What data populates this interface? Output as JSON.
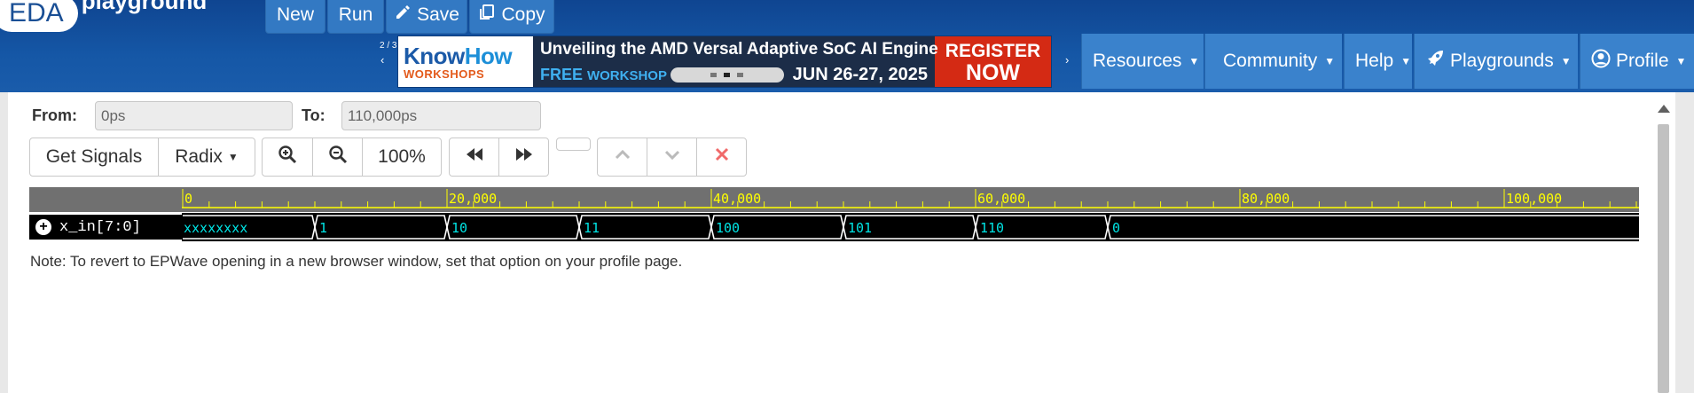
{
  "header": {
    "logo_text": "EDA",
    "logo_sub": "playground",
    "buttons": {
      "new": "New",
      "run": "Run",
      "save": "Save",
      "copy": "Copy"
    },
    "carousel_counter": "2 / 3",
    "ad": {
      "brand_a": "Know",
      "brand_b": "How",
      "brand_sub": "WORKSHOPS",
      "headline": "Unveiling the AMD Versal Adaptive SoC AI Engine",
      "free": "FREE",
      "workshop": "WORKSHOP",
      "date": "JUN 26-27, 2025",
      "cta_line1": "REGISTER",
      "cta_line2": "NOW"
    },
    "nav": [
      "Resources",
      "Community",
      "Help",
      "Playgrounds",
      "Profile"
    ]
  },
  "controls": {
    "from_label": "From:",
    "from_value": "0ps",
    "to_label": "To:",
    "to_value": "110,000ps",
    "get_signals": "Get Signals",
    "radix": "Radix",
    "zoom_level": "100%"
  },
  "waveform": {
    "ruler_labels": [
      "0",
      "20,000",
      "40,000",
      "60,000",
      "80,000",
      "100,000"
    ],
    "signal_name": "x_in[7:0]",
    "segments": [
      {
        "start": 0,
        "value": "xxxxxxxx"
      },
      {
        "start": 10000,
        "value": "1"
      },
      {
        "start": 20000,
        "value": "10"
      },
      {
        "start": 30000,
        "value": "11"
      },
      {
        "start": 40000,
        "value": "100"
      },
      {
        "start": 50000,
        "value": "101"
      },
      {
        "start": 60000,
        "value": "110"
      },
      {
        "start": 70000,
        "value": "0"
      }
    ],
    "time_end": 110000,
    "colors": {
      "ruler_text": "#ffff00",
      "value_text": "#00e5e5",
      "trace": "#ffffff"
    }
  },
  "note": "Note: To revert to EPWave opening in a new browser window, set that option on your profile page."
}
